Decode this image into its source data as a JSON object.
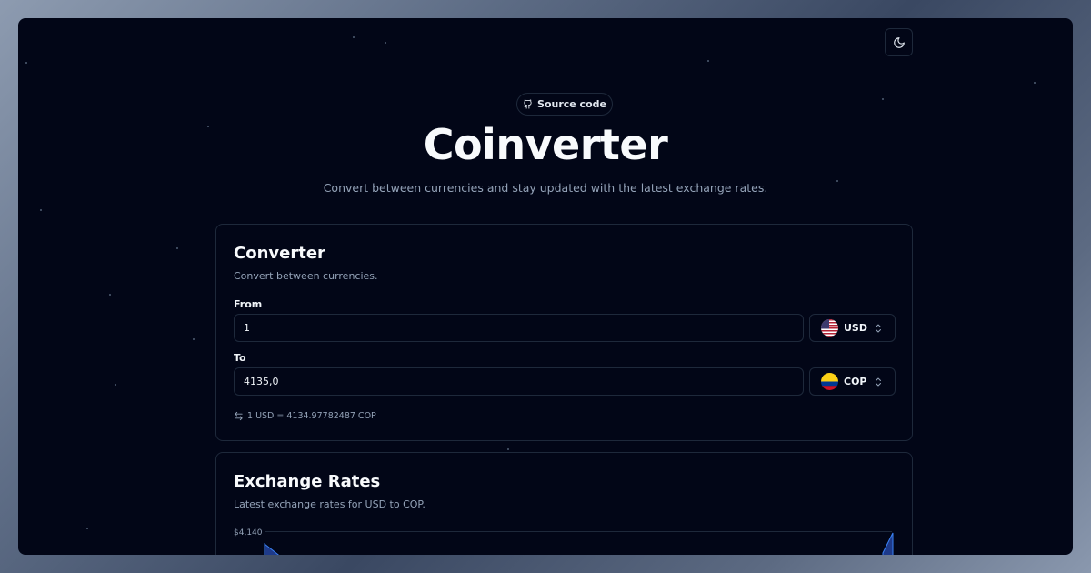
{
  "header": {
    "source_label": "Source code",
    "title": "Coinverter",
    "subtitle": "Convert between currencies and stay updated with the latest exchange rates."
  },
  "icons": {
    "theme_toggle": "moon-icon",
    "source": "github-icon",
    "swap": "swap-arrows-icon"
  },
  "converter": {
    "title": "Converter",
    "description": "Convert between currencies.",
    "from": {
      "label": "From",
      "value": "1",
      "currency": "USD",
      "flag": "us-flag-icon"
    },
    "to": {
      "label": "To",
      "value": "4135,0",
      "currency": "COP",
      "flag": "colombia-flag-icon"
    },
    "rate_text": "1 USD = 4134.97782487 COP"
  },
  "rates": {
    "title": "Exchange Rates",
    "description": "Latest exchange rates for USD to COP.",
    "y_tick_top": "$4,140"
  },
  "colors": {
    "background": "#020617",
    "border": "#1e293b",
    "muted": "#94a3b8",
    "chart_fill": "#1e3a8a"
  },
  "chart_data": {
    "type": "area",
    "title": "",
    "xlabel": "",
    "ylabel": "",
    "y_ticks": [
      "$4,140"
    ]
  }
}
